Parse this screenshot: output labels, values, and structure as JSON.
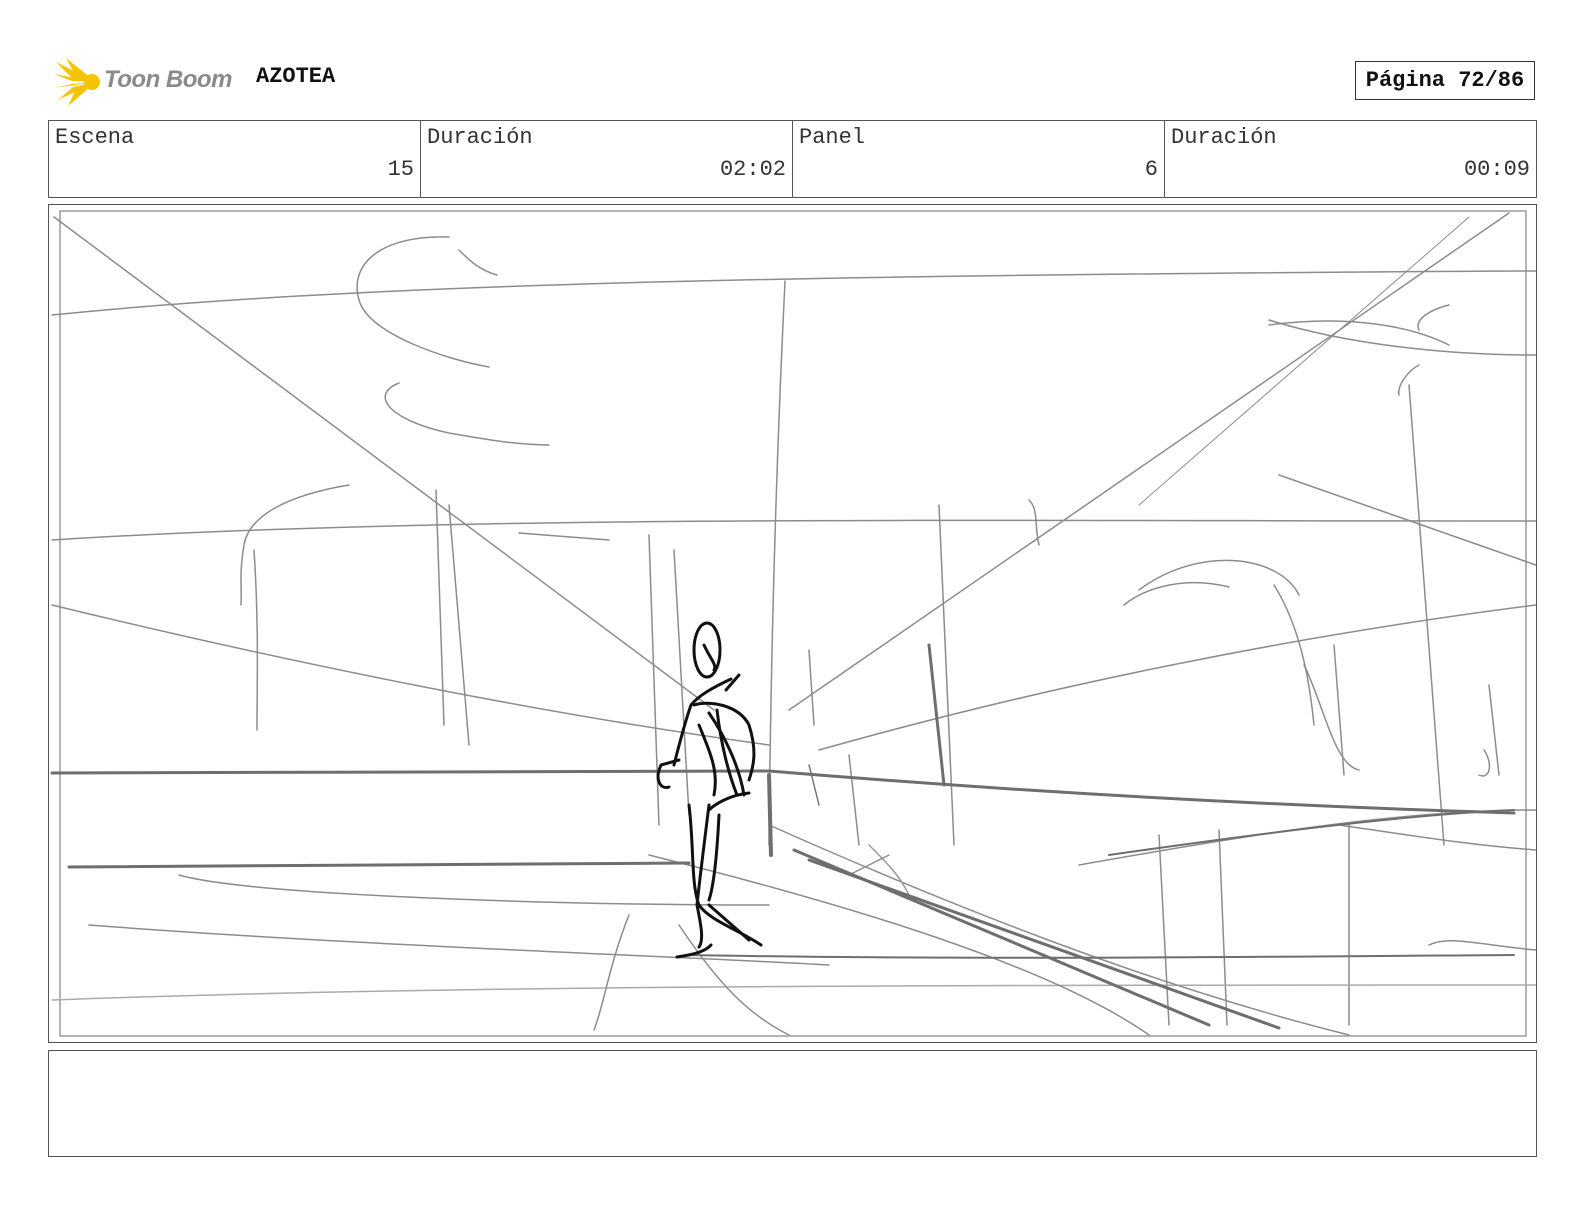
{
  "header": {
    "logo_text": "Toon Boom",
    "project_title": "AZOTEA",
    "page_label": "Página 72/86"
  },
  "info": {
    "scene_label": "Escena",
    "scene_value": "15",
    "scene_duration_label": "Duración",
    "scene_duration_value": "02:02",
    "panel_label": "Panel",
    "panel_value": "6",
    "panel_duration_label": "Duración",
    "panel_duration_value": "00:09"
  },
  "colors": {
    "logo_yellow": "#f5c400",
    "logo_text_gray": "#8a8a8a",
    "sketch_gray": "#8c8c8c",
    "figure_black": "#111111"
  },
  "notes": {
    "text": ""
  }
}
